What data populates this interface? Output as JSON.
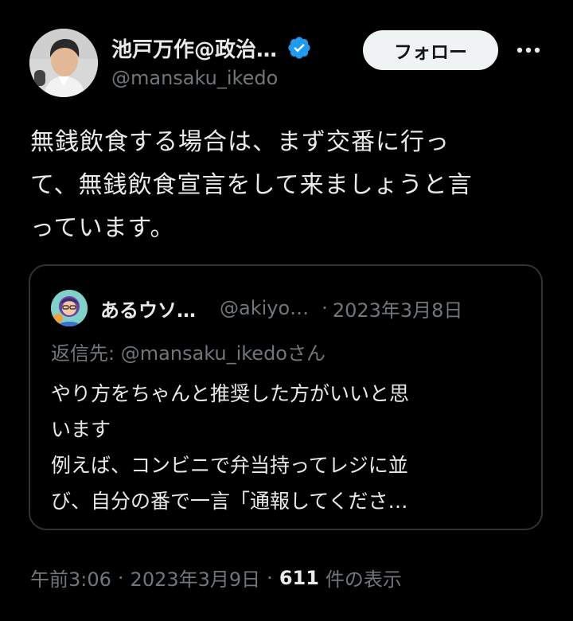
{
  "author": {
    "display_name": "池戸万作@政治…",
    "handle": "@mansaku_ikedo",
    "verified": true,
    "verified_color": "#1d9bf0"
  },
  "actions": {
    "follow_label": "フォロー",
    "more_label": "•••"
  },
  "tweet": {
    "text": "無銭飲食する場合は、まず交番に行っ\nて、無銭飲食宣言をして来ましょうと言\nっています。"
  },
  "quote": {
    "display_name": "あるウソ…",
    "handle": "@akiyo…",
    "separator": "·",
    "date": "2023年3月8日",
    "reply_to": "返信先: @mansaku_ikedoさん",
    "text": "やり方をちゃんと推奨した方がいいと思\nいます\n例えば、コンビニで弁当持ってレジに並\nび、自分の番で一言「通報してくださ…"
  },
  "meta": {
    "time": "午前3:06",
    "separator": "·",
    "date": "2023年3月9日",
    "views_count": "611",
    "views_label": "件の表示"
  }
}
